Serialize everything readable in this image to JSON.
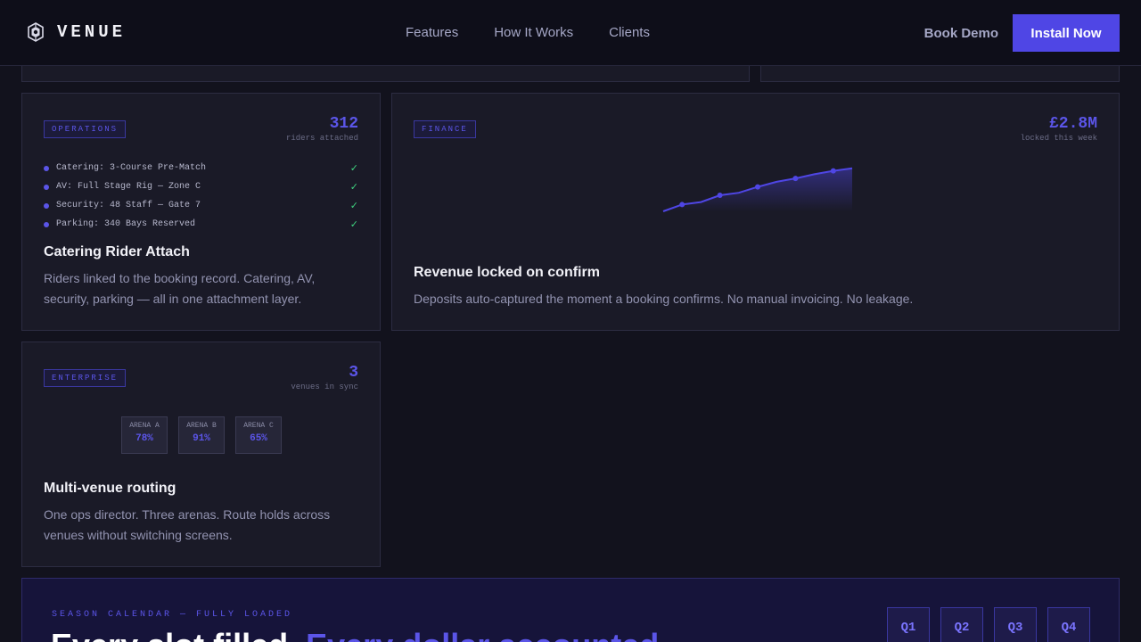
{
  "nav": {
    "brand": "VENUE",
    "links": [
      "Features",
      "How It Works",
      "Clients"
    ],
    "book_demo": "Book Demo",
    "install": "Install Now"
  },
  "cards": {
    "catering": {
      "tag": "OPERATIONS",
      "stat_value": "312",
      "stat_label": "riders attached",
      "items": [
        "Catering: 3-Course Pre-Match",
        "AV: Full Stage Rig — Zone C",
        "Security: 48 Staff — Gate 7",
        "Parking: 340 Bays Reserved"
      ],
      "check": "✓",
      "title": "Catering Rider Attach",
      "desc": "Riders linked to the booking record. Catering, AV, security, parking — all in one attachment layer."
    },
    "finance": {
      "tag": "FINANCE",
      "stat_value": "£2.8M",
      "stat_label": "locked this week",
      "title": "Revenue locked on confirm",
      "desc": "Deposits auto-captured the moment a booking confirms. No manual invoicing. No leakage."
    },
    "enterprise": {
      "tag": "ENTERPRISE",
      "stat_value": "3",
      "stat_label": "venues in sync",
      "venues": [
        {
          "name": "ARENA A",
          "pct": "78%"
        },
        {
          "name": "ARENA B",
          "pct": "91%"
        },
        {
          "name": "ARENA C",
          "pct": "65%"
        }
      ],
      "title": "Multi-venue routing",
      "desc": "One ops director. Three arenas. Route holds across venues without switching screens."
    }
  },
  "chart_data": {
    "type": "area",
    "x": [
      0,
      1,
      2,
      3,
      4,
      5,
      6,
      7,
      8,
      9,
      10
    ],
    "values": [
      0,
      8,
      11,
      19,
      22,
      29,
      35,
      39,
      44,
      48,
      51
    ],
    "ylim": [
      0,
      55
    ],
    "color": "#4f46e5",
    "marked_points": [
      1,
      3,
      5,
      7,
      9
    ]
  },
  "season": {
    "eyebrow": "SEASON CALENDAR — FULLY LOADED",
    "headline_main": "Every slot filled.",
    "headline_accent": "Every dollar accounted.",
    "quarters": [
      "Q1",
      "Q2",
      "Q3",
      "Q4"
    ]
  },
  "colors": {
    "accent": "#4f46e5",
    "check": "#3fd17f",
    "background": "#12121d"
  }
}
